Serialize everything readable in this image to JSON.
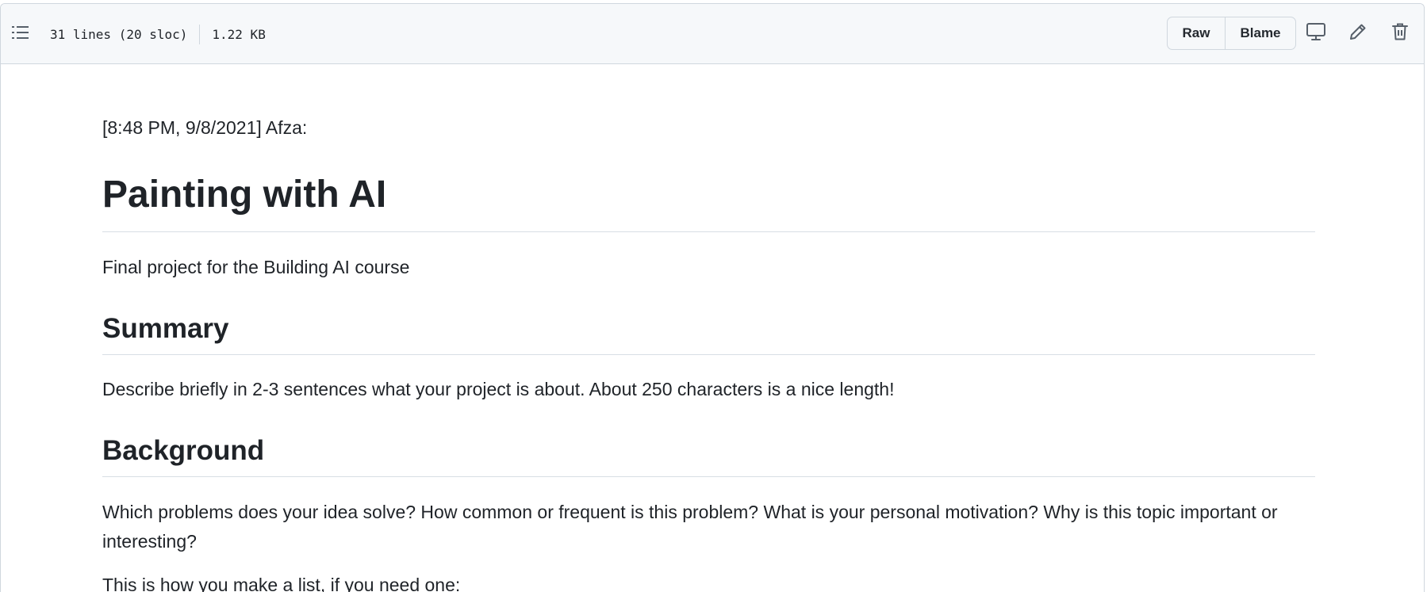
{
  "header": {
    "lines_info": "31 lines (20 sloc)",
    "file_size": "1.22 KB",
    "raw_label": "Raw",
    "blame_label": "Blame",
    "icons": [
      "outline-list-icon",
      "desktop-icon",
      "pencil-icon",
      "trash-icon"
    ]
  },
  "readme": {
    "timestamp_line": "[8:48 PM, 9/8/2021] Afza:",
    "title": "Painting with AI",
    "subtitle": "Final project for the Building AI course",
    "summary_heading": "Summary",
    "summary_text": "Describe briefly in 2-3 sentences what your project is about. About 250 characters is a nice length!",
    "background_heading": "Background",
    "background_text": "Which problems does your idea solve? How common or frequent is this problem? What is your personal motivation? Why is this topic important or interesting?",
    "list_intro": "This is how you make a list, if you need one:"
  },
  "colors": {
    "text": "#1f2328",
    "header_bg": "#f6f8fa",
    "border": "#d0d7de",
    "icon": "#57606a"
  }
}
